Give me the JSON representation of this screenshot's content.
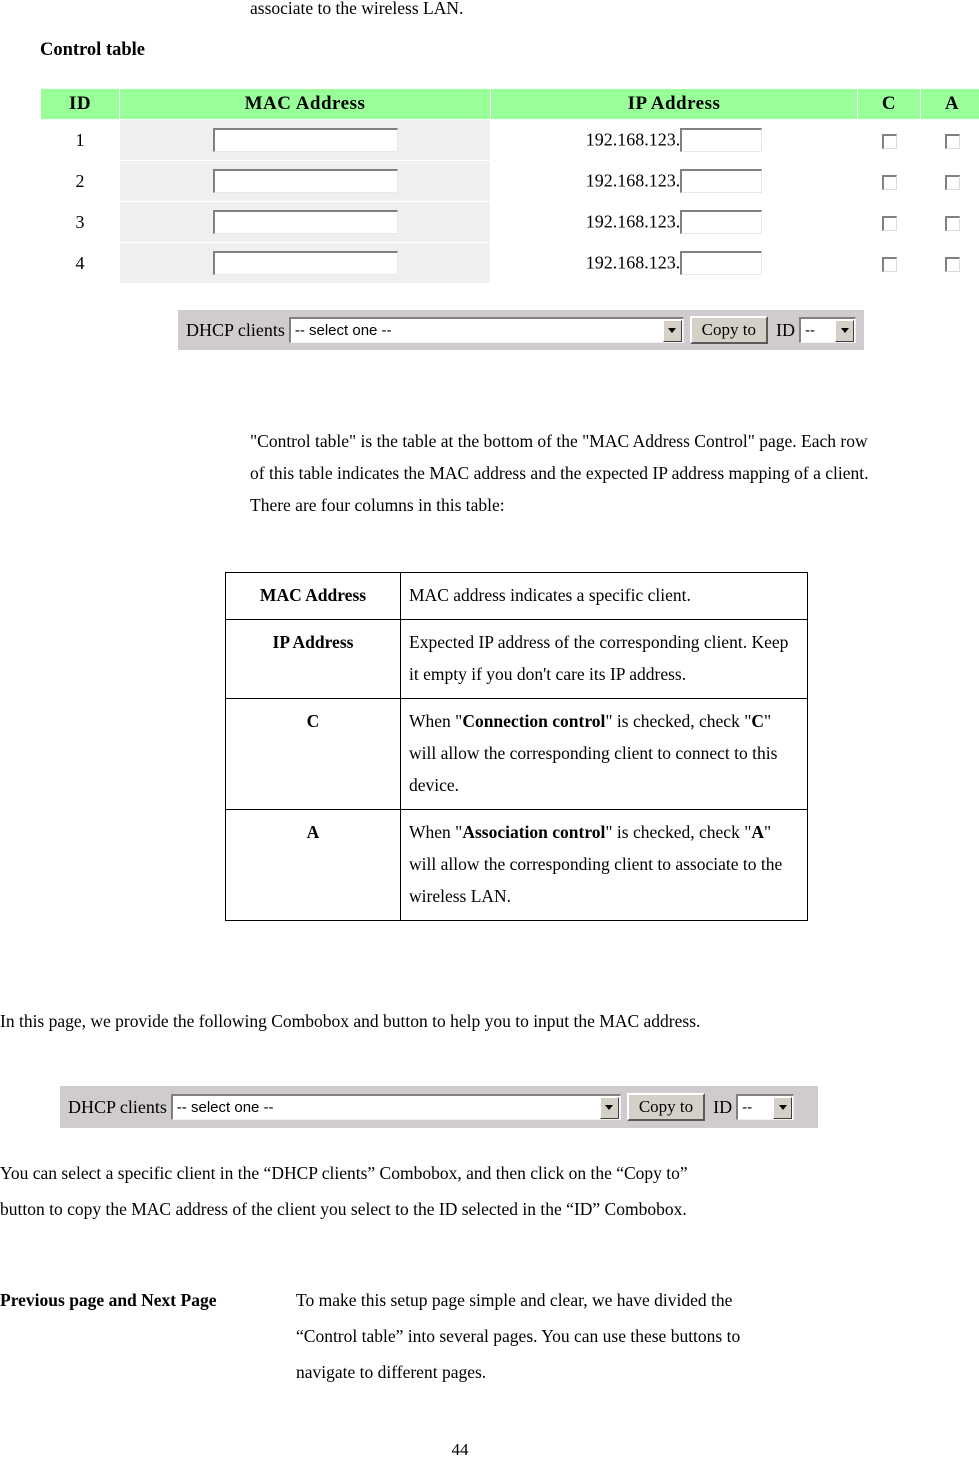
{
  "document": {
    "top_continuation_line": "associate to the wireless LAN.",
    "section_heading": "Control table",
    "page_number": "44"
  },
  "router_screenshot": {
    "headers": [
      "ID",
      "MAC Address",
      "IP Address",
      "C",
      "A"
    ],
    "rows": [
      {
        "id": "1",
        "mac_value": "",
        "ip_prefix": "192.168.123.",
        "ip_value": "",
        "c_checked": false,
        "a_checked": false
      },
      {
        "id": "2",
        "mac_value": "",
        "ip_prefix": "192.168.123.",
        "ip_value": "",
        "c_checked": false,
        "a_checked": false
      },
      {
        "id": "3",
        "mac_value": "",
        "ip_prefix": "192.168.123.",
        "ip_value": "",
        "c_checked": false,
        "a_checked": false
      },
      {
        "id": "4",
        "mac_value": "",
        "ip_prefix": "192.168.123.",
        "ip_value": "",
        "c_checked": false,
        "a_checked": false
      }
    ],
    "header_bg": "#99ff99",
    "row_bg": "#efefef",
    "toolbar_bg": "#cfcbcf"
  },
  "dhcp_toolbar": {
    "label": "DHCP clients",
    "select_value": "-- select one --",
    "copy_button": "Copy to",
    "id_label": "ID",
    "id_select_value": "--"
  },
  "paragraphs": {
    "intro": "\"Control table\" is the table at the bottom of the \"MAC Address Control\" page. Each row of this table indicates the MAC address and the expected IP address mapping of a client. There are four columns in this table:",
    "combobox_intro": "In this page, we provide the following Combobox and button to help you to input the MAC address.",
    "combobox_usage_line1": "You can select a specific client in the “DHCP clients” Combobox, and then click on the “Copy to”",
    "combobox_usage_line2": "button to copy the MAC address of the client you select to the ID selected in the “ID” Combobox."
  },
  "definition_table": {
    "rows": [
      {
        "term": "MAC Address",
        "description_plain": "MAC address indicates a specific client."
      },
      {
        "term": "IP Address",
        "description_plain": "Expected IP address of the corresponding client. Keep it empty if you don't care its IP address."
      },
      {
        "term": "C",
        "description_plain": "When \"Connection control\" is checked, check \"C\" will allow the corresponding client to connect to this device.",
        "bold_terms": [
          "Connection control",
          "C"
        ]
      },
      {
        "term": "A",
        "description_plain": "When \"Association control\" is checked, check \"A\" will allow the corresponding client to associate to the wireless LAN.",
        "bold_terms": [
          "Association control",
          "A"
        ]
      }
    ]
  },
  "prevnext_section": {
    "label": "Previous page and Next Page",
    "body_line1": "To make this setup page simple and clear, we have divided the",
    "body_line2": "“Control table” into several pages. You can use these buttons to",
    "body_line3": "navigate to different pages."
  }
}
